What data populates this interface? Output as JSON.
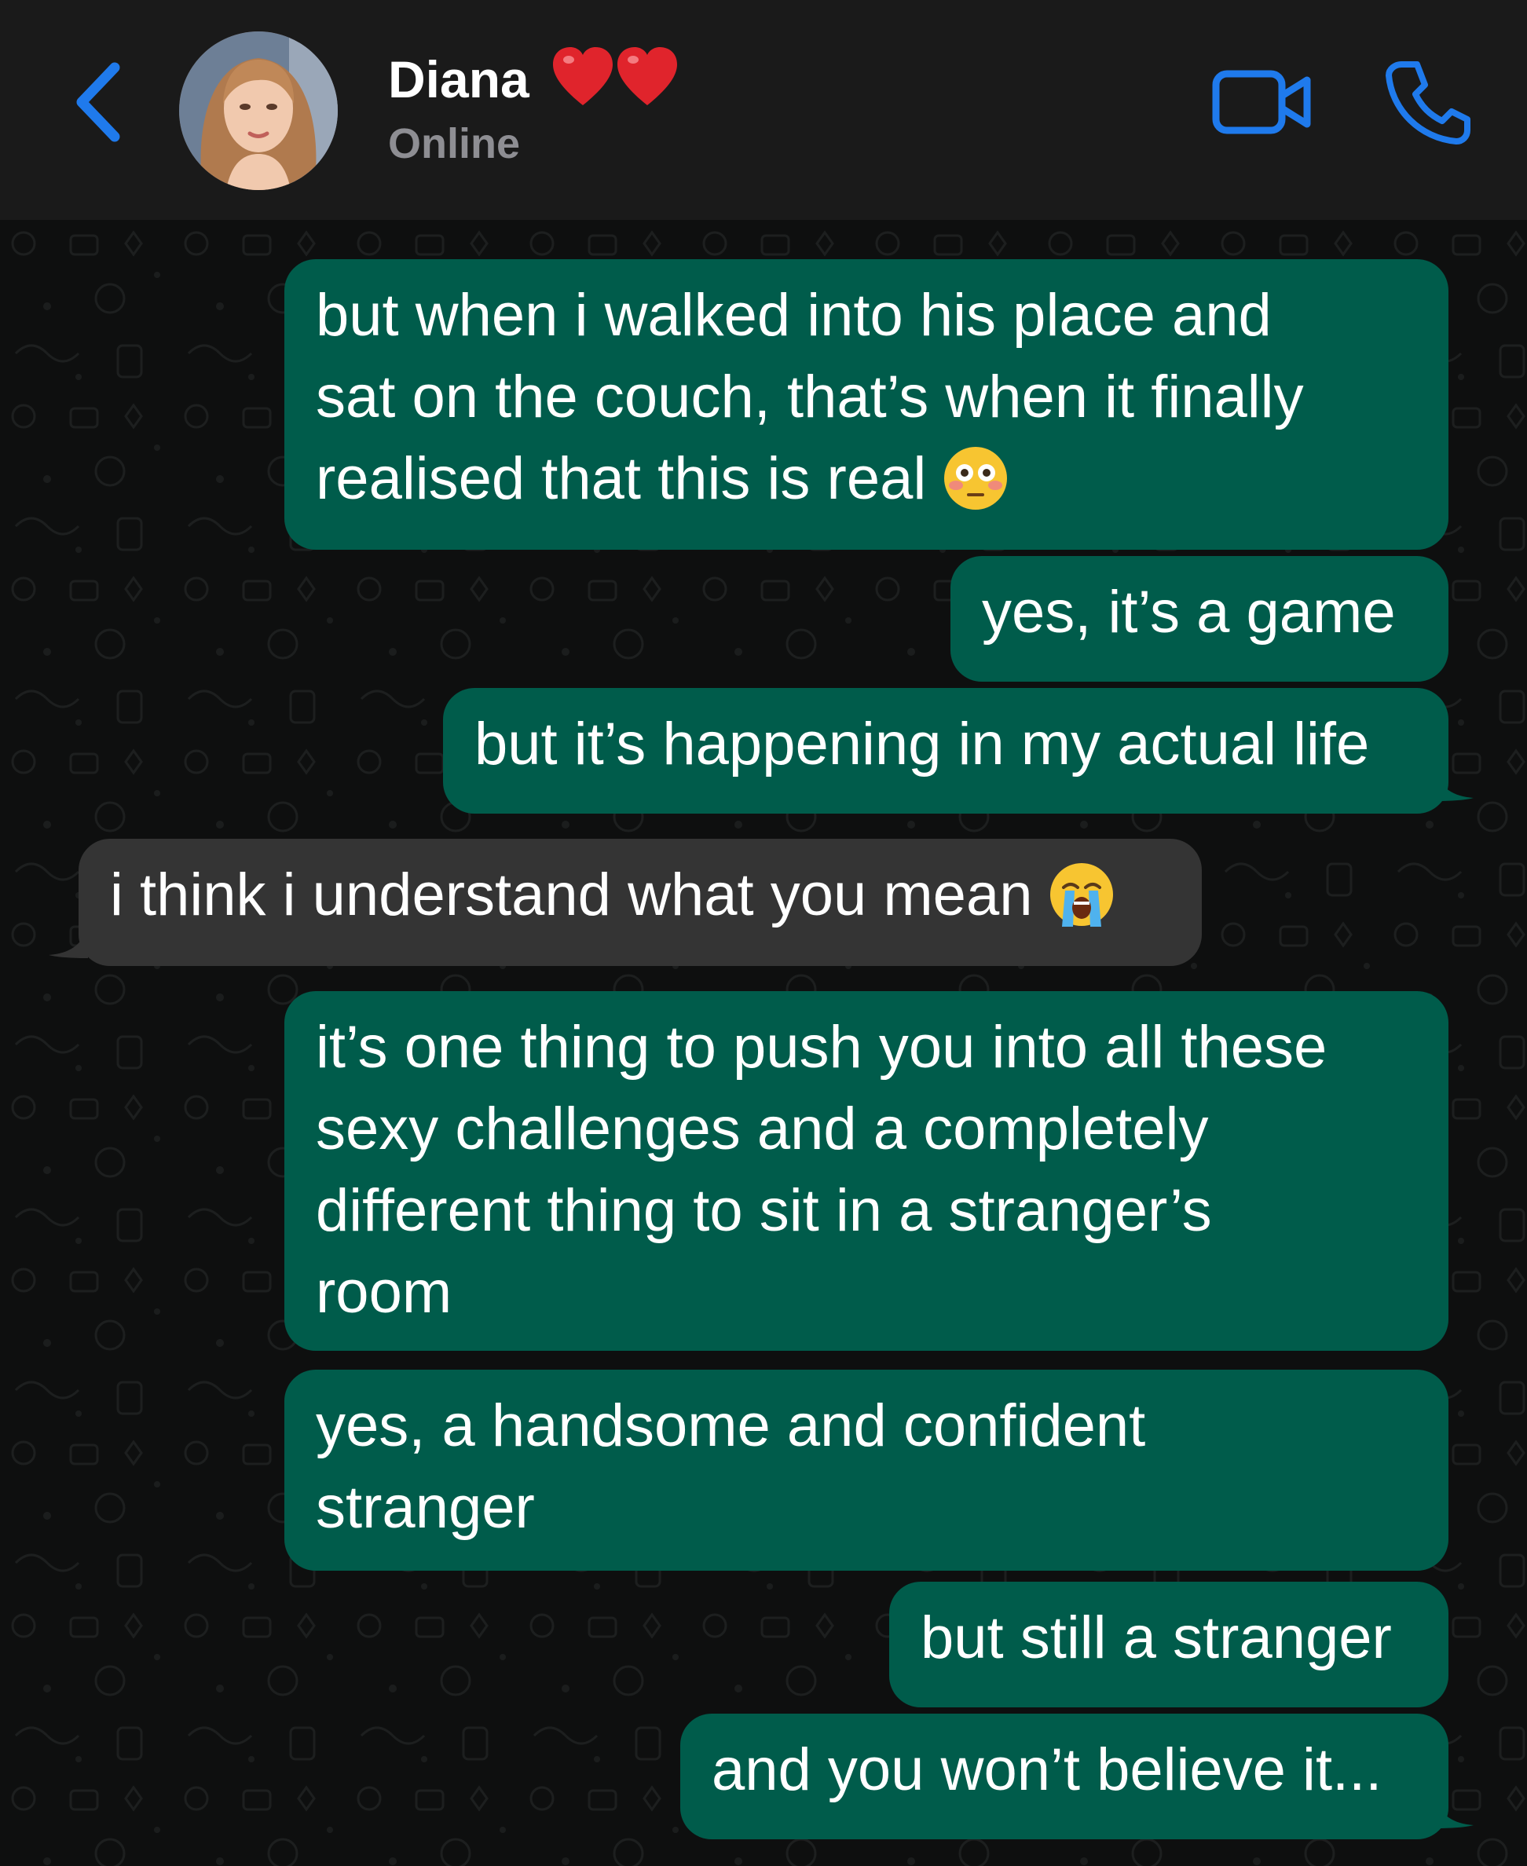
{
  "header": {
    "back_icon": "chevron-left-icon",
    "contact_name": "Diana",
    "name_emoji": "two red hearts",
    "status": "Online",
    "video_icon": "video-camera-icon",
    "call_icon": "phone-icon",
    "accent_color": "#1f7aec"
  },
  "messages": [
    {
      "direction": "outgoing",
      "lines": [
        "but when i walked into his place and",
        "sat on the couch, that’s when it finally",
        "realised that this is real"
      ],
      "emoji": "flushed-face"
    },
    {
      "direction": "outgoing",
      "lines": [
        "yes, it’s a game"
      ]
    },
    {
      "direction": "outgoing",
      "lines": [
        "but it’s happening in my actual life"
      ]
    },
    {
      "direction": "incoming",
      "lines": [
        "i think i understand what you mean"
      ],
      "emoji": "loudly-crying-face"
    },
    {
      "direction": "outgoing",
      "lines": [
        "it’s one thing to push you into all these",
        "sexy challenges and a completely",
        "different thing to sit in a stranger’s",
        "room"
      ]
    },
    {
      "direction": "outgoing",
      "lines": [
        "yes, a handsome and confident",
        "stranger"
      ]
    },
    {
      "direction": "outgoing",
      "lines": [
        "but still a stranger"
      ]
    },
    {
      "direction": "outgoing",
      "lines": [
        "and you won’t believe it..."
      ]
    }
  ],
  "colors": {
    "outgoing_bubble": "#005c4b",
    "incoming_bubble": "#343434",
    "header_background": "#1a1a1a",
    "chat_background": "#0e0f0f"
  }
}
